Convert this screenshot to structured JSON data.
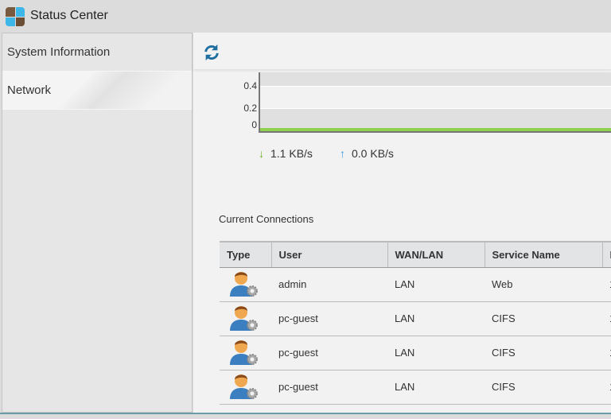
{
  "app": {
    "title": "Status Center",
    "icon": "status-center-app-icon"
  },
  "sidebar": {
    "items": [
      {
        "label": "System Information",
        "selected": false
      },
      {
        "label": "Network",
        "selected": true
      }
    ]
  },
  "toolbar": {
    "refresh_icon": "refresh-icon"
  },
  "chart_data": {
    "type": "line",
    "y_ticks": [
      "0.4",
      "0.2",
      "0"
    ],
    "ylim": [
      0,
      0.5
    ],
    "series": [
      {
        "color": "#8fd14f",
        "values": [
          0,
          0,
          0,
          0,
          0
        ]
      }
    ],
    "grid": true
  },
  "legend": {
    "download": "1.1 KB/s",
    "upload": "0.0 KB/s",
    "download_color": "#6aae1e",
    "upload_color": "#3a9be0"
  },
  "connections": {
    "title": "Current Connections",
    "columns": [
      "Type",
      "User",
      "WAN/LAN",
      "Service Name",
      "I"
    ],
    "rows": [
      {
        "user": "admin",
        "wanlan": "LAN",
        "service": "Web",
        "extra": "1"
      },
      {
        "user": "pc-guest",
        "wanlan": "LAN",
        "service": "CIFS",
        "extra": "1"
      },
      {
        "user": "pc-guest",
        "wanlan": "LAN",
        "service": "CIFS",
        "extra": "1"
      },
      {
        "user": "pc-guest",
        "wanlan": "LAN",
        "service": "CIFS",
        "extra": "1"
      }
    ]
  }
}
